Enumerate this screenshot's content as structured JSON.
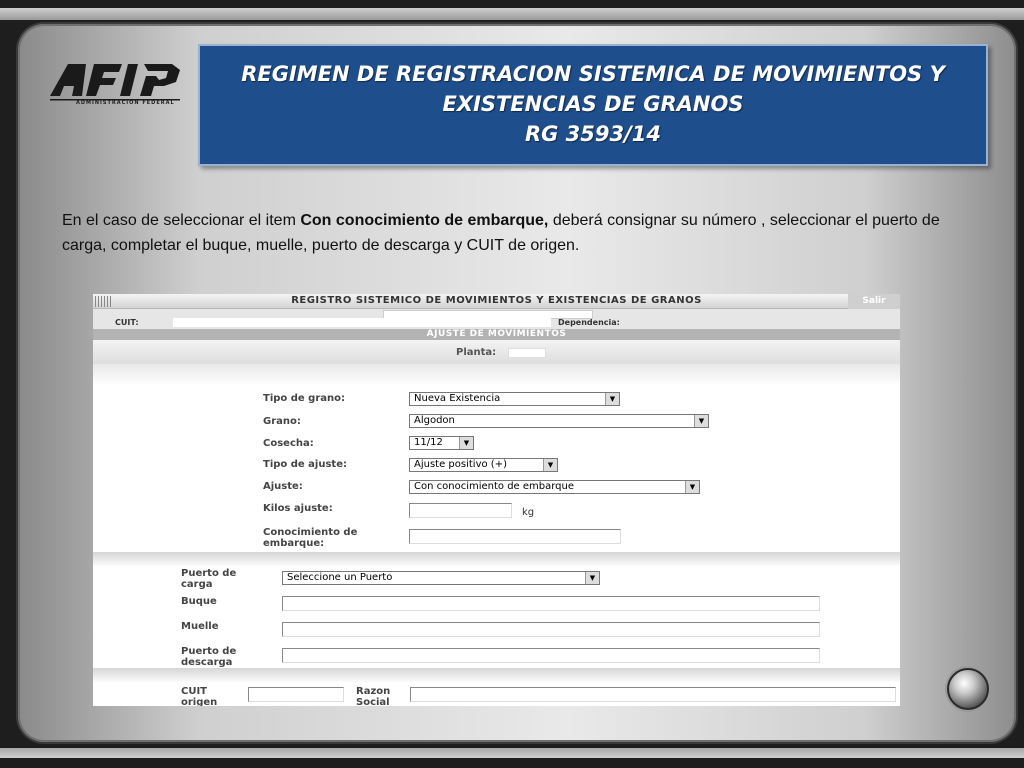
{
  "slide": {
    "logo_text": "AFIP",
    "logo_subtitle": "ADMINISTRACION FEDERAL",
    "title_line1": "REGIMEN DE REGISTRACION SISTEMICA DE MOVIMIENTOS Y",
    "title_line2": "EXISTENCIAS DE GRANOS",
    "title_line3": "RG  3593/14",
    "desc_part1": "En el caso de seleccionar el item ",
    "desc_bold": "Con conocimiento de embarque,",
    "desc_part2": " deberá consignar su número , seleccionar el puerto de carga, completar el buque, muelle, puerto de descarga y CUIT de origen.",
    "colors": {
      "banner": "#1f4e8c",
      "frame": "#d9d9d9"
    }
  },
  "app": {
    "title": "REGISTRO SISTEMICO DE MOVIMIENTOS Y EXISTENCIAS DE GRANOS",
    "salir": "Salir",
    "cuit_label": "CUIT:",
    "dependencia_label": "Dependencia:",
    "section_title": "AJUSTE DE MOVIMIENTOS",
    "planta_label": "Planta:",
    "fields": {
      "tipo_grano_label": "Tipo de grano:",
      "tipo_grano_value": "Nueva Existencia",
      "grano_label": "Grano:",
      "grano_value": "Algodon",
      "cosecha_label": "Cosecha:",
      "cosecha_value": "11/12",
      "tipo_ajuste_label": "Tipo de ajuste:",
      "tipo_ajuste_value": "Ajuste positivo (+)",
      "ajuste_label": "Ajuste:",
      "ajuste_value": "Con conocimiento de embarque",
      "kilos_label": "Kilos ajuste:",
      "kilos_unit": "kg",
      "conocimiento_label_1": "Conocimiento de",
      "conocimiento_label_2": "embarque:",
      "puerto_carga_label_1": "Puerto de",
      "puerto_carga_label_2": "carga",
      "puerto_carga_value": "Seleccione un Puerto",
      "buque_label": "Buque",
      "muelle_label": "Muelle",
      "puerto_descarga_label_1": "Puerto de",
      "puerto_descarga_label_2": "descarga",
      "cuit_origen_label_1": "CUIT",
      "cuit_origen_label_2": "origen",
      "razon_social_label_1": "Razon",
      "razon_social_label_2": "Social"
    }
  }
}
